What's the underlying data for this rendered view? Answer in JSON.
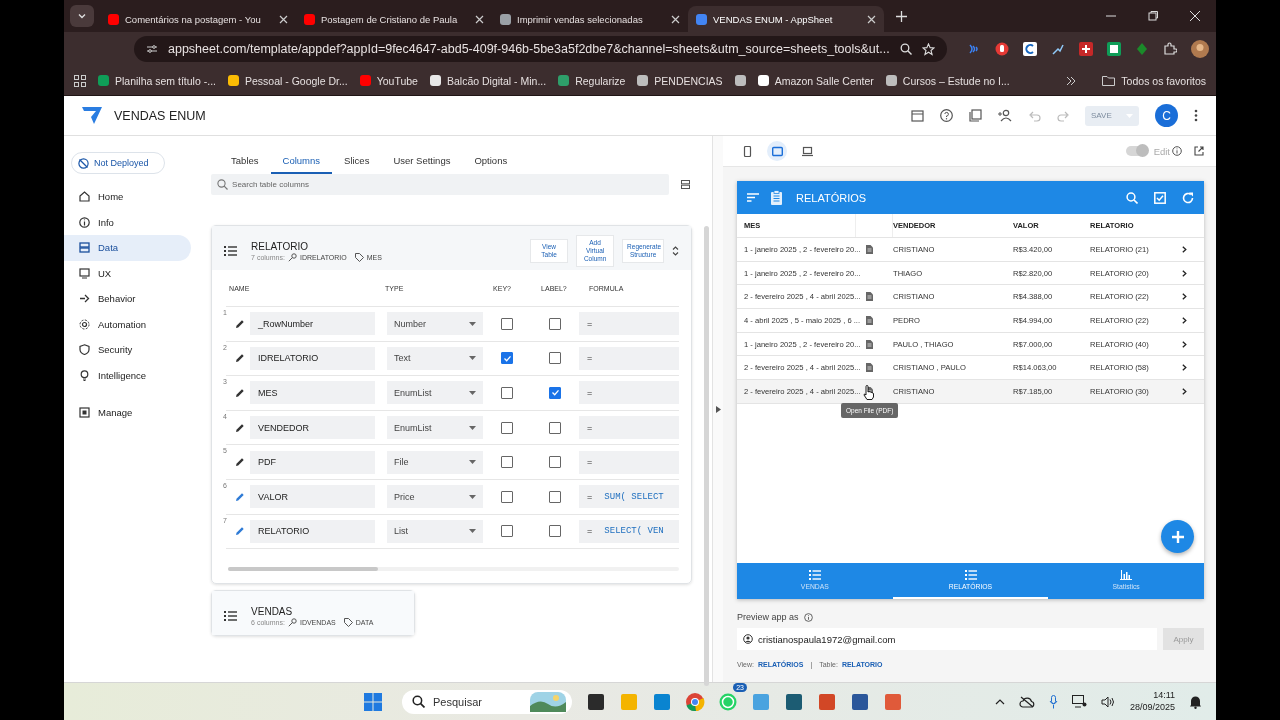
{
  "browser": {
    "tabs": [
      {
        "title": "Comentários na postagem - You",
        "color": "#ff0000",
        "selected": false
      },
      {
        "title": "Postagem de Cristiano de Paula",
        "color": "#ff0000",
        "selected": false
      },
      {
        "title": "Imprimir vendas selecionadas",
        "color": "#9aa0a6",
        "selected": false
      },
      {
        "title": "VENDAS ENUM - AppSheet",
        "color": "#4285f4",
        "selected": true
      }
    ],
    "url": "appsheet.com/template/appdef?appId=9fec4647-abd5-409f-946b-5be3a5f2dbe7&channel=sheets&utm_source=sheets_tools&ut...",
    "bookmarks": [
      {
        "title": "Planilha sem título -...",
        "color": "#0f9d58"
      },
      {
        "title": "Pessoal - Google Dr...",
        "color": "#fbbc04"
      },
      {
        "title": "YouTube",
        "color": "#ff0000"
      },
      {
        "title": "Balcão Digital - Min...",
        "color": "#e8e8e8"
      },
      {
        "title": "Regularize",
        "color": "#2e9e6a"
      },
      {
        "title": "PENDENCIAS",
        "color": "#bdbdbd"
      },
      {
        "color": "#bdbdbd"
      },
      {
        "title": "Amazon Salle Center",
        "color": "#ffffff"
      },
      {
        "title": "Cursos – Estude no I...",
        "color": "#bdbdbd"
      }
    ],
    "all_bookmarks": "Todos os favoritos"
  },
  "app": {
    "title": "VENDAS ENUM",
    "save": "SAVE",
    "avatar": "C"
  },
  "deploy_status": "Not Deployed",
  "nav": [
    {
      "label": "Home",
      "selected": false
    },
    {
      "label": "Info",
      "selected": false
    },
    {
      "label": "Data",
      "selected": true
    },
    {
      "label": "UX",
      "selected": false
    },
    {
      "label": "Behavior",
      "selected": false
    },
    {
      "label": "Automation",
      "selected": false
    },
    {
      "label": "Security",
      "selected": false
    },
    {
      "label": "Intelligence",
      "selected": false
    },
    {
      "label": "Manage",
      "selected": false
    }
  ],
  "data_tabs": [
    {
      "label": "Tables",
      "selected": false
    },
    {
      "label": "Columns",
      "selected": true
    },
    {
      "label": "Slices",
      "selected": false
    },
    {
      "label": "User Settings",
      "selected": false
    },
    {
      "label": "Options",
      "selected": false
    }
  ],
  "search": {
    "placeholder": "Search table columns"
  },
  "tables": [
    {
      "name": "RELATORIO",
      "count": "7 columns:",
      "key": "IDRELATORIO",
      "label": "MES",
      "actions": [
        "View Table",
        "Add Virtual Column",
        "Regenerate Structure"
      ],
      "headers": [
        "NAME",
        "TYPE",
        "KEY?",
        "LABEL?",
        "FORMULA"
      ],
      "columns": [
        {
          "num": "1",
          "name": "_RowNumber",
          "type": "Number",
          "key": false,
          "label": false,
          "virtual": false,
          "sign": "="
        },
        {
          "num": "2",
          "name": "IDRELATORIO",
          "type": "Text",
          "key": true,
          "label": false,
          "virtual": false,
          "sign": "="
        },
        {
          "num": "3",
          "name": "MES",
          "type": "EnumList",
          "key": false,
          "label": true,
          "virtual": false,
          "sign": "="
        },
        {
          "num": "4",
          "name": "VENDEDOR",
          "type": "EnumList",
          "key": false,
          "label": false,
          "virtual": false,
          "sign": "="
        },
        {
          "num": "5",
          "name": "PDF",
          "type": "File",
          "key": false,
          "label": false,
          "virtual": false,
          "sign": "="
        },
        {
          "num": "6",
          "name": "VALOR",
          "type": "Price",
          "key": false,
          "label": false,
          "virtual": true,
          "sign": "=",
          "expr": "SUM( SELECT"
        },
        {
          "num": "7",
          "name": "RELATORIO",
          "type": "List",
          "key": false,
          "label": false,
          "virtual": true,
          "sign": "=",
          "expr": "SELECT( VEN"
        }
      ]
    },
    {
      "name": "VENDAS",
      "count": "6 columns:",
      "key": "IDVENDAS",
      "label": "DATA"
    }
  ],
  "preview": {
    "devices": [
      {
        "kind": "phone",
        "selected": false
      },
      {
        "kind": "tablet",
        "selected": true
      },
      {
        "kind": "desktop",
        "selected": false
      }
    ],
    "edit": {
      "label": "Edit",
      "on": true
    },
    "view_title": "RELATÓRIOS",
    "headers": [
      "MES",
      "VENDEDOR",
      "VALOR",
      "RELATORIO"
    ],
    "rows": [
      {
        "mes": "1 - janeiro 2025 , 2 - fevereiro 20...",
        "pdf": true,
        "vendedor": "CRISTIANO",
        "valor": "R$3.420,00",
        "relatorio": "RELATORIO (21)",
        "hovered": false
      },
      {
        "mes": "1 - janeiro 2025 , 2 - fevereiro 20...",
        "pdf": false,
        "vendedor": "THIAGO",
        "valor": "R$2.820,00",
        "relatorio": "RELATORIO (20)",
        "hovered": false
      },
      {
        "mes": "2 - fevereiro 2025 , 4 - abril 2025...",
        "pdf": true,
        "vendedor": "CRISTIANO",
        "valor": "R$4.388,00",
        "relatorio": "RELATORIO (22)",
        "hovered": false
      },
      {
        "mes": "4 - abril 2025 , 5 - maio 2025 , 6 ...",
        "pdf": true,
        "vendedor": "PEDRO",
        "valor": "R$4.994,00",
        "relatorio": "RELATORIO (22)",
        "hovered": false
      },
      {
        "mes": "1 - janeiro 2025 , 2 - fevereiro 20...",
        "pdf": true,
        "vendedor": "PAULO , THIAGO",
        "valor": "R$7.000,00",
        "relatorio": "RELATORIO (40)",
        "hovered": false
      },
      {
        "mes": "2 - fevereiro 2025 , 4 - abril 2025...",
        "pdf": true,
        "vendedor": "CRISTIANO , PAULO",
        "valor": "R$14.063,00",
        "relatorio": "RELATORIO (58)",
        "hovered": false
      },
      {
        "mes": "2 - fevereiro 2025 , 4 - abril 2025...",
        "pdf": true,
        "vendedor": "CRISTIANO",
        "valor": "R$7.185,00",
        "relatorio": "RELATORIO (30)",
        "hovered": true
      }
    ],
    "tooltip": "Open File (PDF)",
    "bottom_nav": [
      {
        "label": "VENDAS",
        "kind": "list",
        "selected": false
      },
      {
        "label": "RELATÓRIOS",
        "kind": "list",
        "selected": true
      },
      {
        "label": "Statistics",
        "kind": "chart",
        "selected": false
      }
    ],
    "preview_as": "Preview app as",
    "email": "cristianospaula1972@gmail.com",
    "apply": "Apply",
    "view_label": "View:",
    "view_value": "RELATÓRIOS",
    "separator": "|",
    "table_label": "Table:",
    "table_value": "RELATORIO"
  },
  "taskbar": {
    "search": "Pesquisar",
    "badge": "23",
    "time": "14:11",
    "date": "28/09/2025"
  }
}
